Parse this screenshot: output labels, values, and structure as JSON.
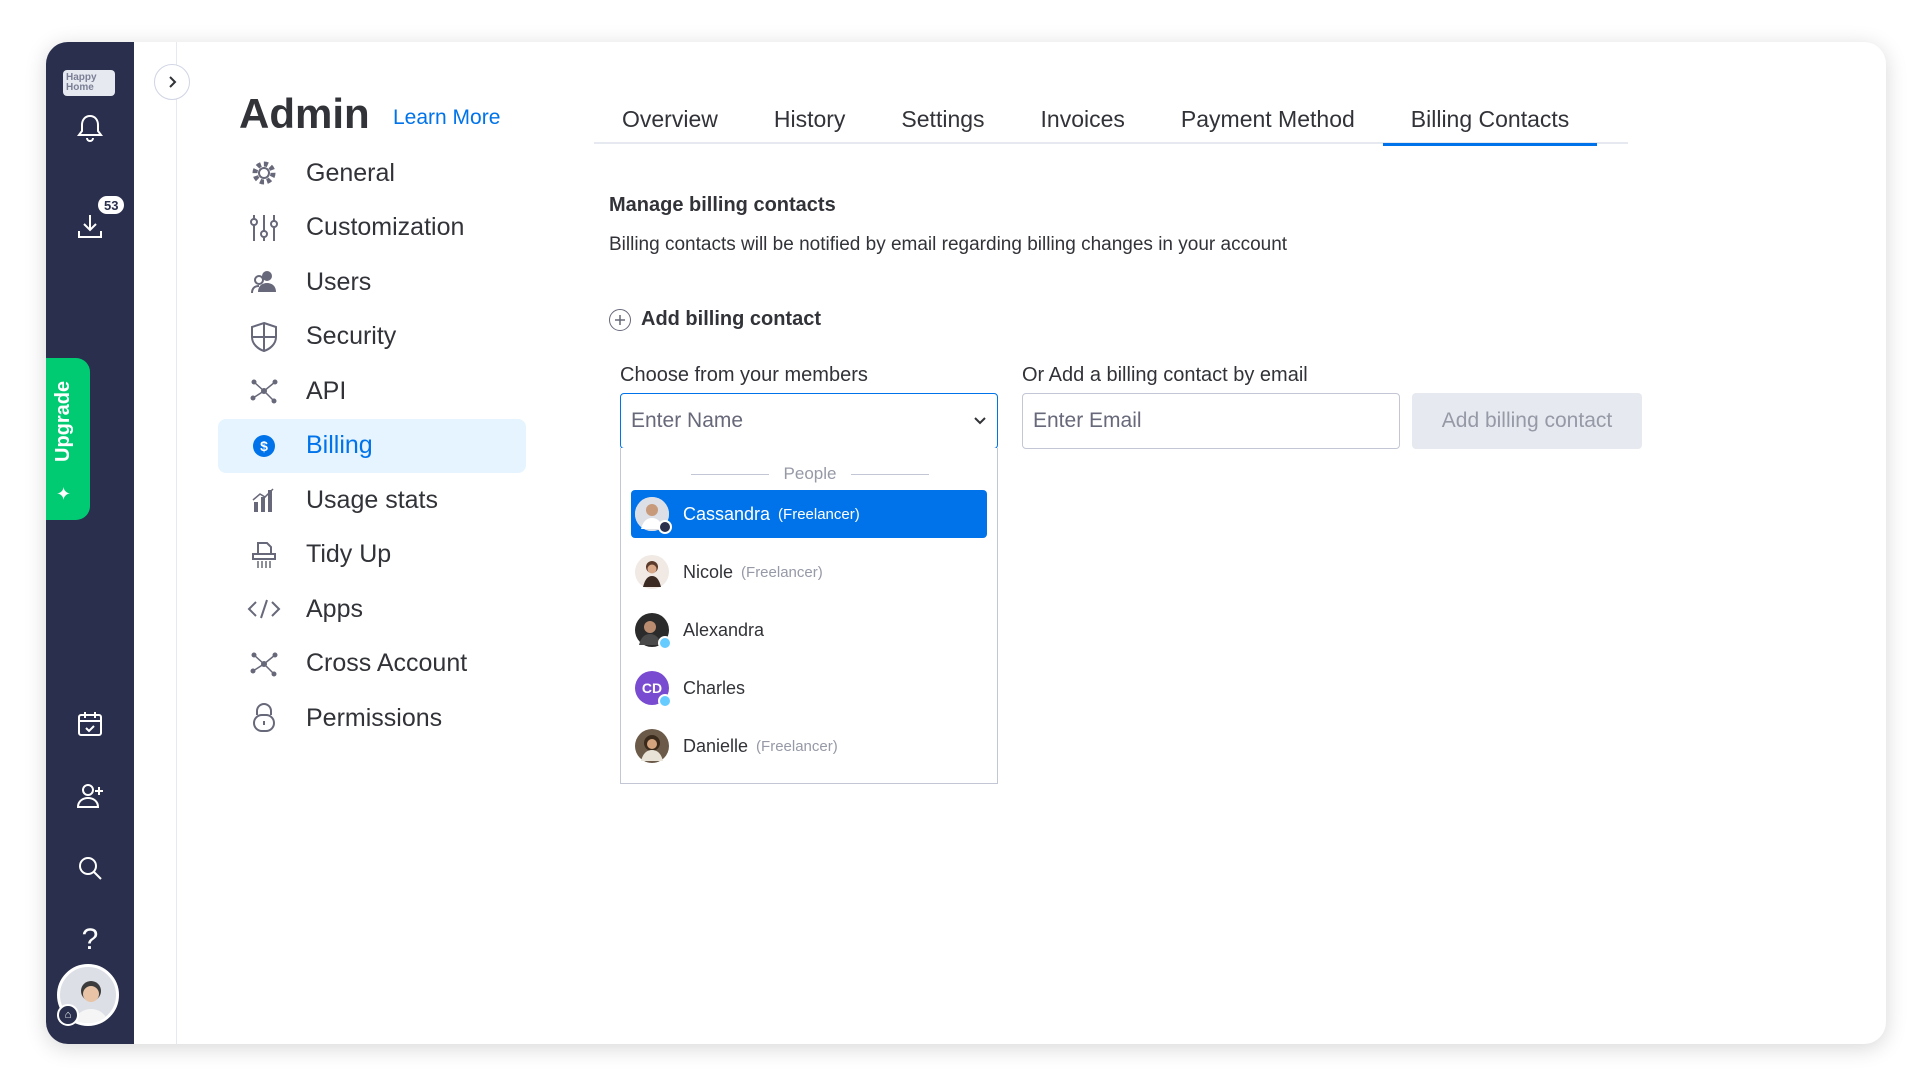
{
  "rail": {
    "logo_text": "Happy Home",
    "notification_count": "53",
    "upgrade_label": "Upgrade",
    "icons": [
      "bell-icon",
      "download-icon",
      "calendar-check-icon",
      "invite-user-icon",
      "search-icon",
      "help-icon"
    ]
  },
  "header": {
    "title": "Admin",
    "learn_more": "Learn More"
  },
  "nav": {
    "items": [
      {
        "label": "General",
        "icon": "gear-icon"
      },
      {
        "label": "Customization",
        "icon": "sliders-icon"
      },
      {
        "label": "Users",
        "icon": "users-icon"
      },
      {
        "label": "Security",
        "icon": "shield-icon"
      },
      {
        "label": "API",
        "icon": "api-nodes-icon"
      },
      {
        "label": "Billing",
        "icon": "dollar-circle-icon"
      },
      {
        "label": "Usage stats",
        "icon": "bar-chart-icon"
      },
      {
        "label": "Tidy Up",
        "icon": "shredder-icon"
      },
      {
        "label": "Apps",
        "icon": "code-icon"
      },
      {
        "label": "Cross Account",
        "icon": "network-icon"
      },
      {
        "label": "Permissions",
        "icon": "lock-icon"
      }
    ],
    "active": "Billing"
  },
  "tabs": {
    "items": [
      "Overview",
      "History",
      "Settings",
      "Invoices",
      "Payment Method",
      "Billing Contacts"
    ],
    "active": "Billing Contacts"
  },
  "content": {
    "heading": "Manage billing contacts",
    "description": "Billing contacts will be notified by email regarding billing changes in your account",
    "add_label": "Add billing contact",
    "members_label": "Choose from your members",
    "email_label": "Or Add a billing contact by email",
    "name_placeholder": "Enter Name",
    "email_placeholder": "Enter Email",
    "add_button": "Add billing contact"
  },
  "dropdown": {
    "group_label": "People",
    "options": [
      {
        "name": "Cassandra",
        "tag": "(Freelancer)",
        "selected": true
      },
      {
        "name": "Nicole",
        "tag": "(Freelancer)",
        "selected": false
      },
      {
        "name": "Alexandra",
        "tag": "",
        "selected": false
      },
      {
        "name": "Charles",
        "tag": "",
        "initials": "CD",
        "selected": false
      },
      {
        "name": "Danielle",
        "tag": "(Freelancer)",
        "selected": false
      }
    ]
  },
  "colors": {
    "rail_bg": "#292f4c",
    "accent": "#0073ea",
    "upgrade": "#00ca72",
    "active_nav_bg": "#e5f4ff"
  }
}
